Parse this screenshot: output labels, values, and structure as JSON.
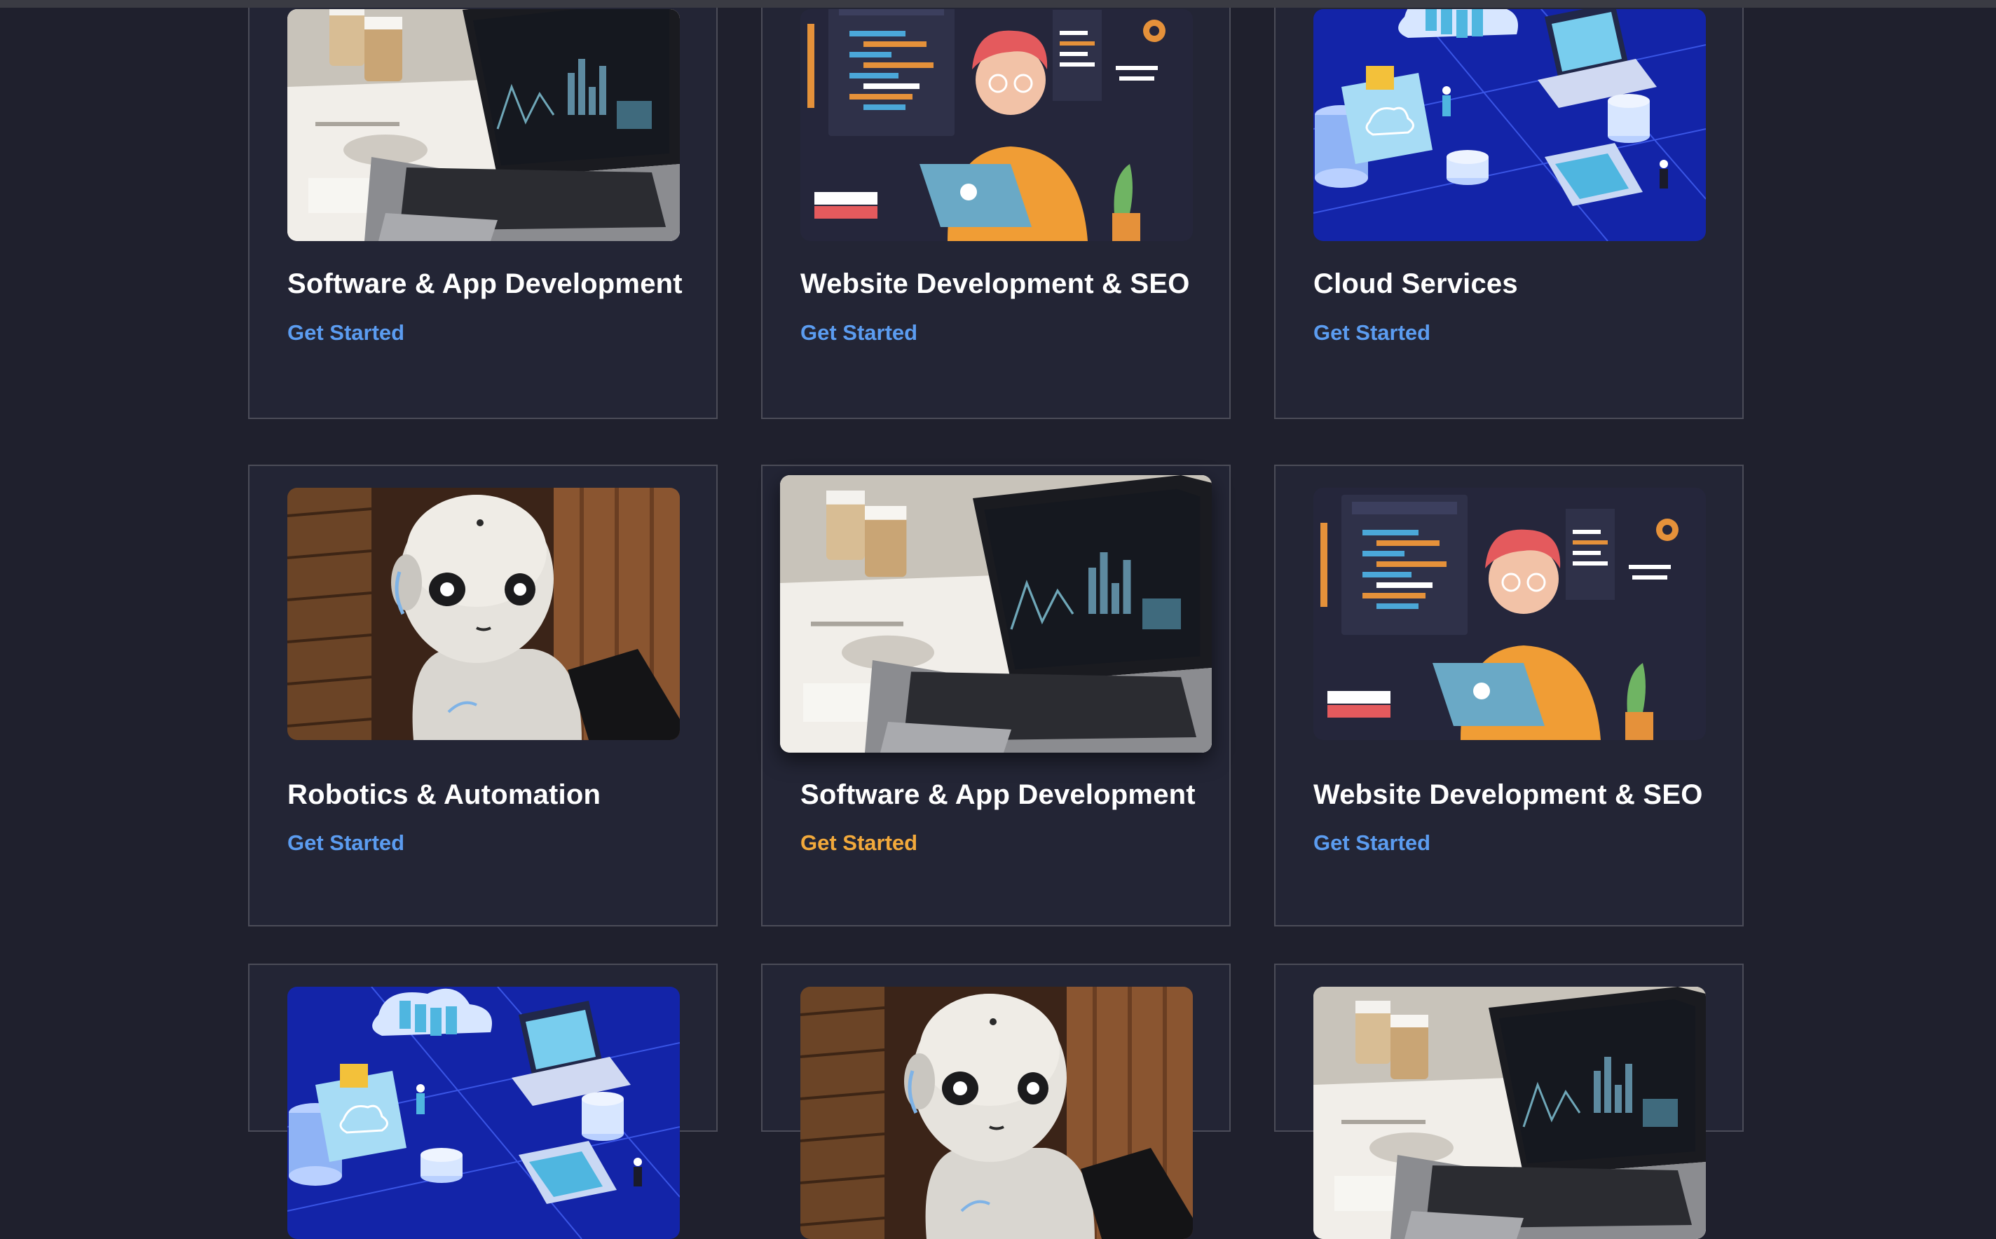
{
  "colors": {
    "page_background": "#1f202d",
    "card_background": "#232535",
    "card_border": "#4b4c58",
    "link": "#5b9cf0",
    "link_hover": "#f2a93b"
  },
  "services": {
    "cards": [
      {
        "title": "Software & App Development",
        "cta": "Get Started",
        "image": "laptop-analytics-photo"
      },
      {
        "title": "Website Development & SEO",
        "cta": "Get Started",
        "image": "web-developer-illustration"
      },
      {
        "title": "Cloud Services",
        "cta": "Get Started",
        "image": "cloud-network-illustration"
      },
      {
        "title": "Robotics & Automation",
        "cta": "Get Started",
        "image": "robot-photo"
      },
      {
        "title": "Software & App Development",
        "cta": "Get Started",
        "image": "laptop-analytics-photo",
        "state": "hovered"
      },
      {
        "title": "Website Development & SEO",
        "cta": "Get Started",
        "image": "web-developer-illustration"
      },
      {
        "title": "",
        "cta": "",
        "image": "cloud-network-illustration"
      },
      {
        "title": "",
        "cta": "",
        "image": "robot-photo"
      },
      {
        "title": "",
        "cta": "",
        "image": "laptop-analytics-photo"
      }
    ]
  }
}
